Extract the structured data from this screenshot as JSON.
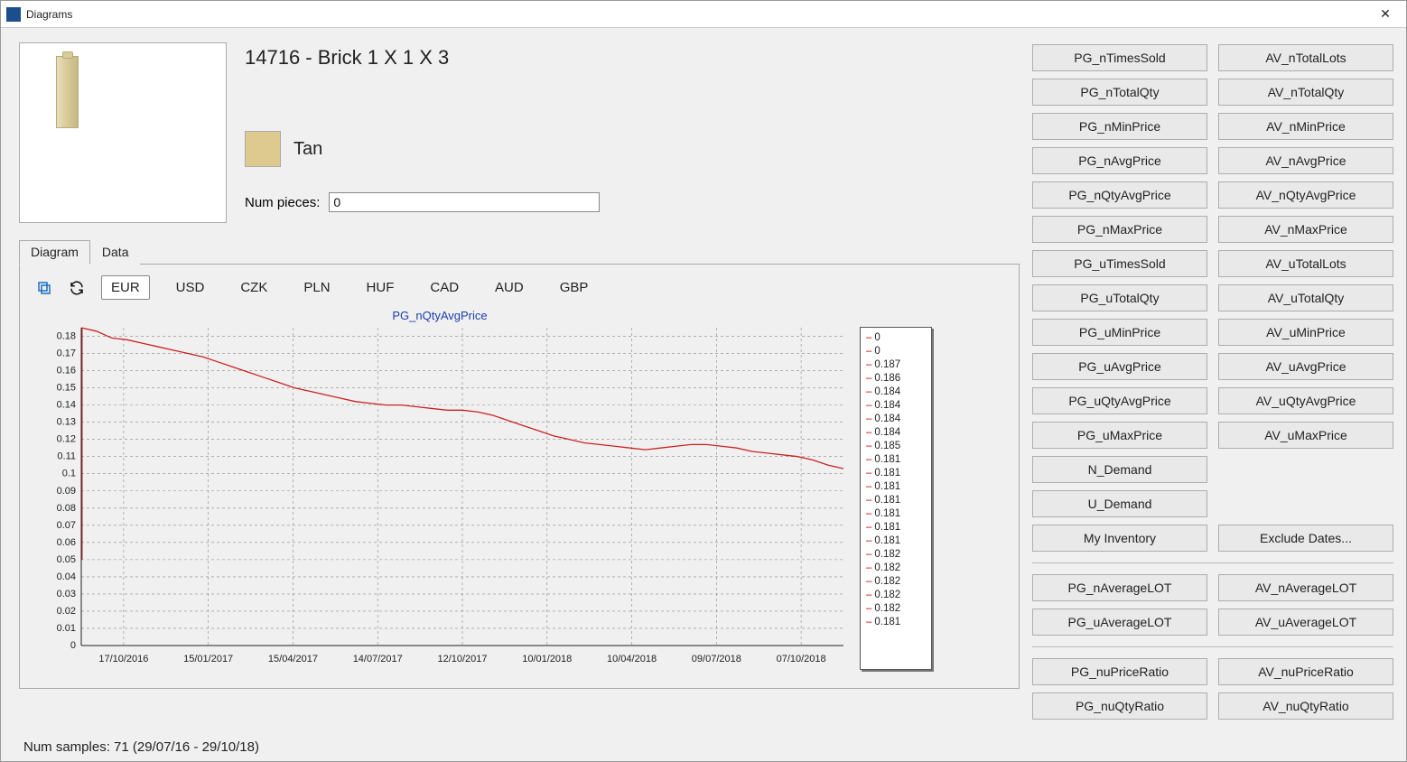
{
  "window": {
    "title": "Diagrams"
  },
  "part": {
    "title": "14716 - Brick 1 X 1 X 3",
    "color_name": "Tan",
    "swatch_hex": "#dec98f",
    "num_pieces_label": "Num pieces:",
    "num_pieces_value": "0"
  },
  "tabs": {
    "diagram": "Diagram",
    "data": "Data"
  },
  "currencies": [
    "EUR",
    "USD",
    "CZK",
    "PLN",
    "HUF",
    "CAD",
    "AUD",
    "GBP"
  ],
  "currency_selected": "EUR",
  "chart_data": {
    "type": "line",
    "title": "PG_nQtyAvgPrice",
    "xlabel": "",
    "ylabel": "",
    "ylim": [
      0,
      0.18
    ],
    "yticks": [
      0,
      0.01,
      0.02,
      0.03,
      0.04,
      0.05,
      0.06,
      0.07,
      0.08,
      0.09,
      0.1,
      0.11,
      0.12,
      0.13,
      0.14,
      0.15,
      0.16,
      0.17,
      0.18
    ],
    "x_categories": [
      "17/10/2016",
      "15/01/2017",
      "15/04/2017",
      "14/07/2017",
      "12/10/2017",
      "10/01/2018",
      "10/04/2018",
      "09/07/2018",
      "07/10/2018"
    ],
    "series": [
      {
        "name": "PG_nQtyAvgPrice",
        "values": [
          0.187,
          0.186,
          0.184,
          0.184,
          0.184,
          0.184,
          0.185,
          0.181,
          0.181,
          0.181,
          0.181,
          0.181,
          0.181,
          0.181,
          0.182,
          0.182,
          0.182,
          0.182,
          0.182,
          0.181,
          0.185,
          0.183,
          0.179,
          0.178,
          0.176,
          0.174,
          0.172,
          0.17,
          0.168,
          0.165,
          0.162,
          0.159,
          0.156,
          0.153,
          0.15,
          0.148,
          0.146,
          0.144,
          0.142,
          0.141,
          0.14,
          0.14,
          0.139,
          0.138,
          0.137,
          0.137,
          0.136,
          0.134,
          0.131,
          0.128,
          0.125,
          0.122,
          0.12,
          0.118,
          0.117,
          0.116,
          0.115,
          0.114,
          0.115,
          0.116,
          0.117,
          0.117,
          0.116,
          0.115,
          0.113,
          0.112,
          0.111,
          0.11,
          0.108,
          0.105,
          0.103
        ]
      }
    ]
  },
  "legend": [
    "0",
    "0",
    "0.187",
    "0.186",
    "0.184",
    "0.184",
    "0.184",
    "0.184",
    "0.185",
    "0.181",
    "0.181",
    "0.181",
    "0.181",
    "0.181",
    "0.181",
    "0.181",
    "0.182",
    "0.182",
    "0.182",
    "0.182",
    "0.182",
    "0.181"
  ],
  "button_rows": [
    [
      "PG_nTimesSold",
      "AV_nTotalLots"
    ],
    [
      "PG_nTotalQty",
      "AV_nTotalQty"
    ],
    [
      "PG_nMinPrice",
      "AV_nMinPrice"
    ],
    [
      "PG_nAvgPrice",
      "AV_nAvgPrice"
    ],
    [
      "PG_nQtyAvgPrice",
      "AV_nQtyAvgPrice"
    ],
    [
      "PG_nMaxPrice",
      "AV_nMaxPrice"
    ],
    [
      "PG_uTimesSold",
      "AV_uTotalLots"
    ],
    [
      "PG_uTotalQty",
      "AV_uTotalQty"
    ],
    [
      "PG_uMinPrice",
      "AV_uMinPrice"
    ],
    [
      "PG_uAvgPrice",
      "AV_uAvgPrice"
    ],
    [
      "PG_uQtyAvgPrice",
      "AV_uQtyAvgPrice"
    ],
    [
      "PG_uMaxPrice",
      "AV_uMaxPrice"
    ],
    [
      "N_Demand",
      ""
    ],
    [
      "U_Demand",
      ""
    ],
    [
      "My Inventory",
      "Exclude Dates..."
    ]
  ],
  "button_rows2": [
    [
      "PG_nAverageLOT",
      "AV_nAverageLOT"
    ],
    [
      "PG_uAverageLOT",
      "AV_uAverageLOT"
    ]
  ],
  "button_rows3": [
    [
      "PG_nuPriceRatio",
      "AV_nuPriceRatio"
    ],
    [
      "PG_nuQtyRatio",
      "AV_nuQtyRatio"
    ]
  ],
  "status": "Num samples: 71 (29/07/16 - 29/10/18)"
}
